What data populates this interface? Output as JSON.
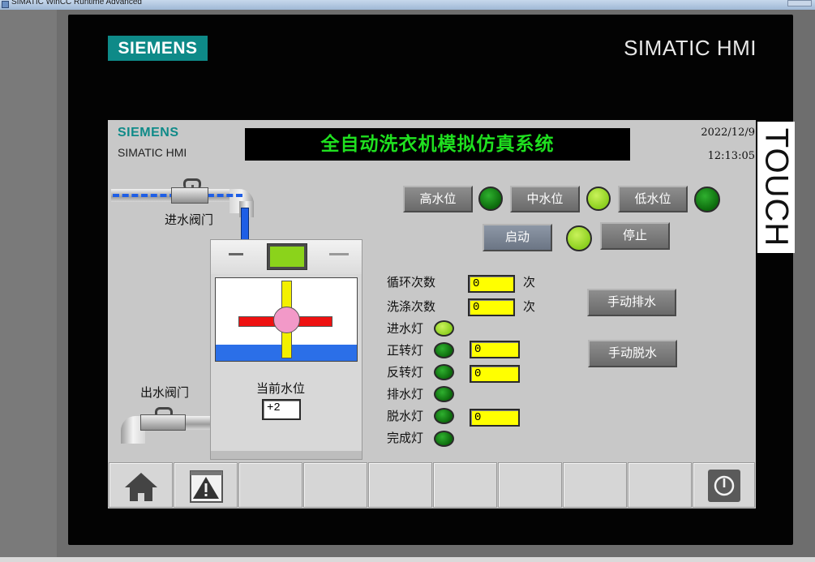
{
  "window": {
    "title": "SIMATIC WinCC Runtime Advanced"
  },
  "device": {
    "brand": "SIEMENS",
    "model": "SIMATIC HMI",
    "touch_label": "TOUCH"
  },
  "screen": {
    "brand": "SIEMENS",
    "model": "SIMATIC HMI",
    "title": "全自动洗衣机模拟仿真系统",
    "date": "2022/12/9",
    "time": "12:13:05"
  },
  "level_buttons": [
    {
      "label": "高水位",
      "lamp": "green-dark"
    },
    {
      "label": "中水位",
      "lamp": "green-light"
    },
    {
      "label": "低水位",
      "lamp": "green-dark"
    }
  ],
  "controls": {
    "start": "启动",
    "stop": "停止",
    "run_lamp": "green-light",
    "manual_drain": "手动排水",
    "manual_spin": "手动脱水"
  },
  "pipes": {
    "inlet_valve": "进水阀门",
    "outlet_valve": "出水阀门"
  },
  "machine": {
    "level_label": "当前水位",
    "level_value": "+2"
  },
  "counters": {
    "cycle_label": "循环次数",
    "cycle_value": "0",
    "cycle_unit": "次",
    "wash_label": "洗涤次数",
    "wash_value": "0",
    "wash_unit": "次"
  },
  "indicators": [
    {
      "label": "进水灯",
      "state": "green-light",
      "value": null
    },
    {
      "label": "正转灯",
      "state": "green-dark",
      "value": "0"
    },
    {
      "label": "反转灯",
      "state": "green-dark",
      "value": "0"
    },
    {
      "label": "排水灯",
      "state": "green-dark",
      "value": null
    },
    {
      "label": "脱水灯",
      "state": "green-dark",
      "value": "0"
    },
    {
      "label": "完成灯",
      "state": "green-dark",
      "value": null
    }
  ],
  "nav": [
    {
      "icon": "home-icon"
    },
    {
      "icon": "alarm-icon"
    },
    {
      "icon": ""
    },
    {
      "icon": ""
    },
    {
      "icon": ""
    },
    {
      "icon": ""
    },
    {
      "icon": ""
    },
    {
      "icon": ""
    },
    {
      "icon": ""
    },
    {
      "icon": "power-icon"
    }
  ]
}
